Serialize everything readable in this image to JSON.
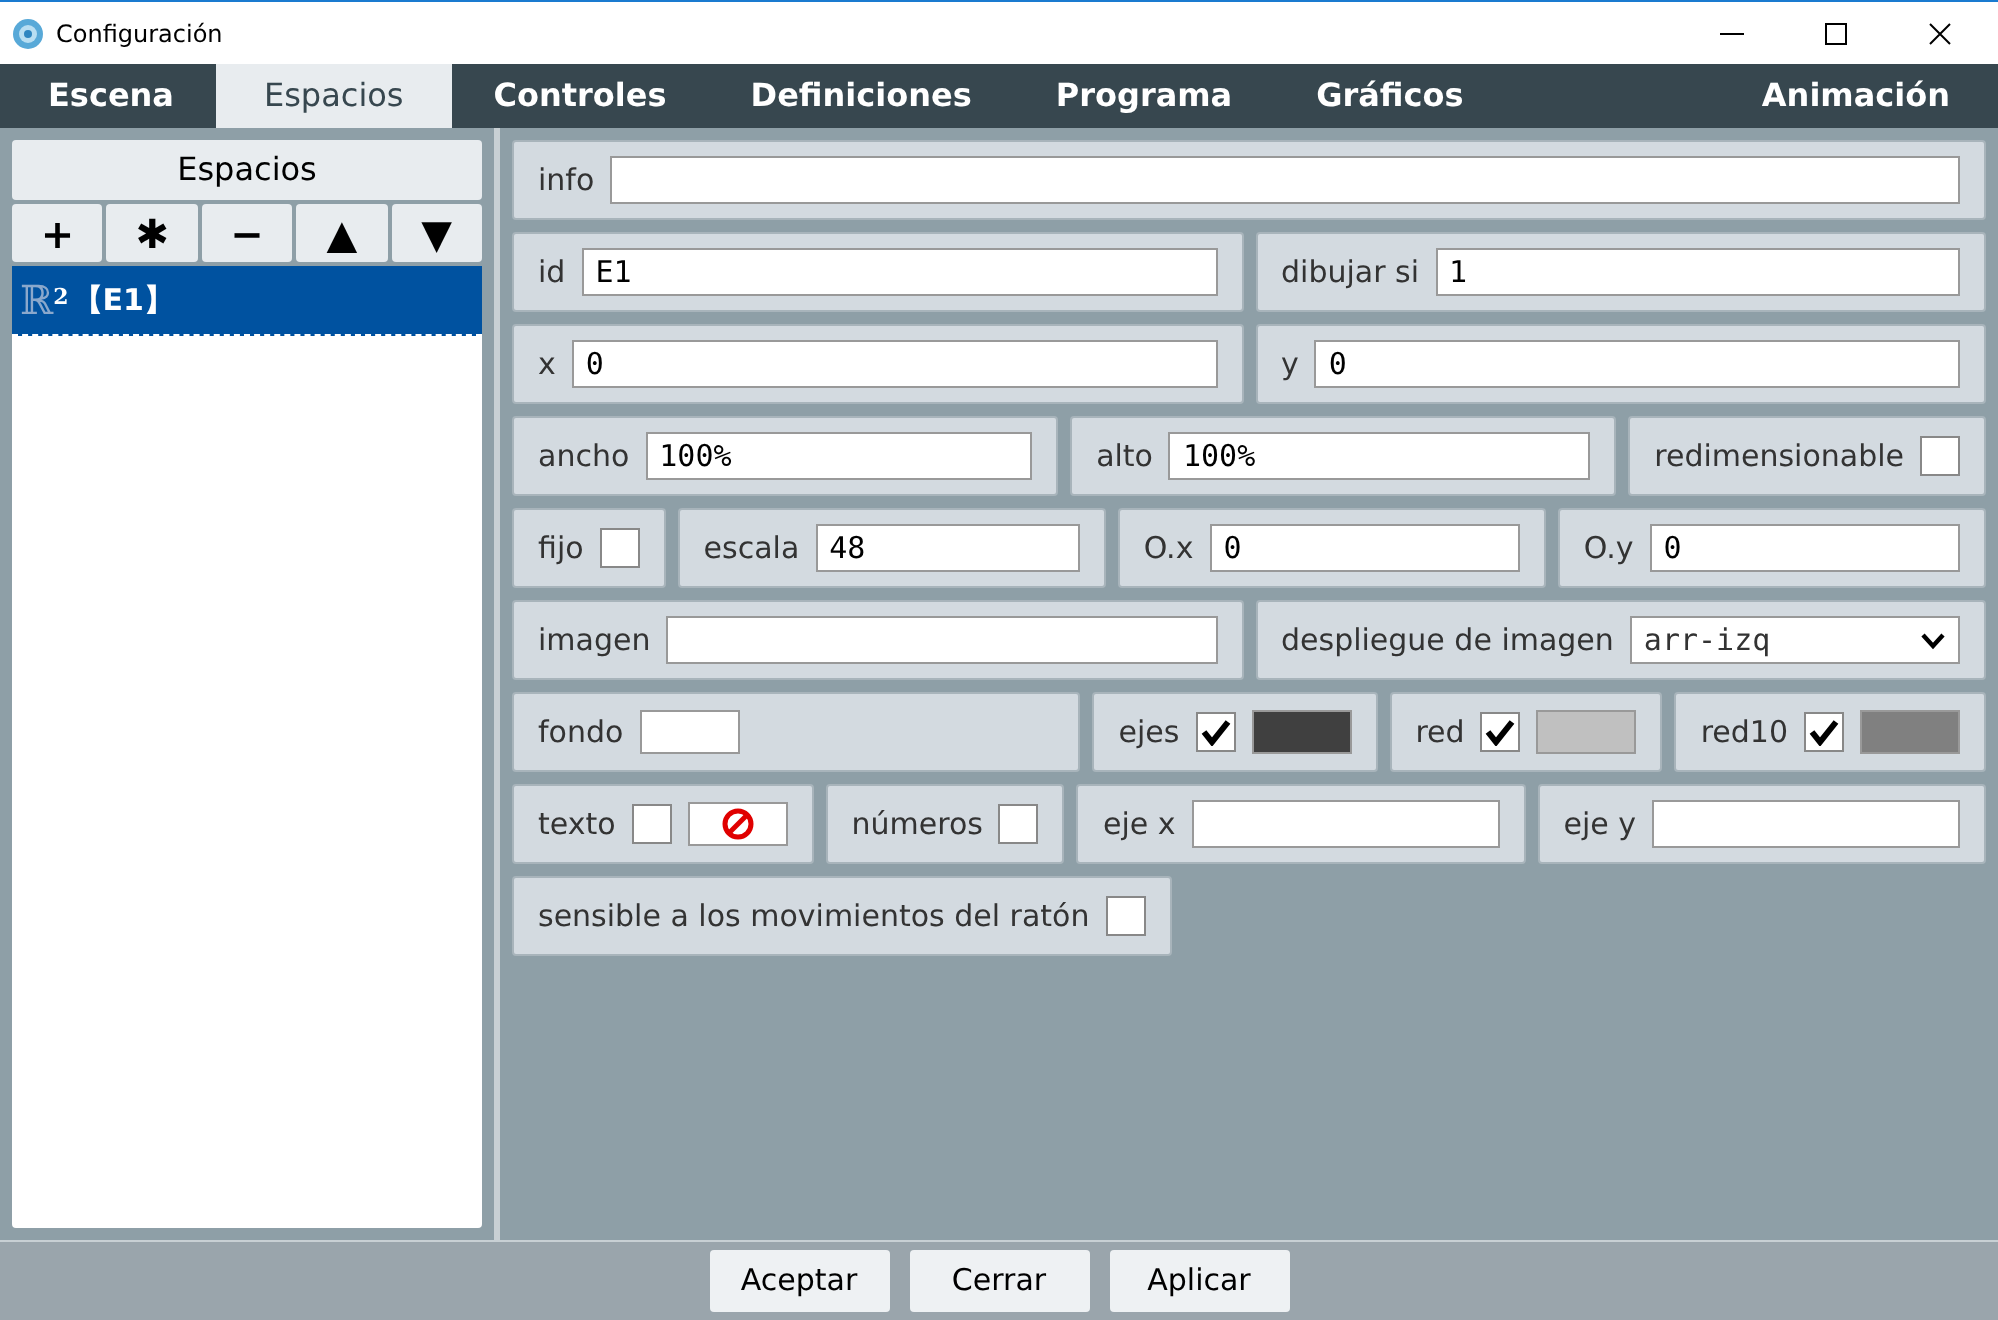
{
  "window": {
    "title": "Configuración"
  },
  "tabs": [
    {
      "label": "Escena",
      "selected": false
    },
    {
      "label": "Espacios",
      "selected": true
    },
    {
      "label": "Controles",
      "selected": false
    },
    {
      "label": "Definiciones",
      "selected": false
    },
    {
      "label": "Programa",
      "selected": false
    },
    {
      "label": "Gráficos",
      "selected": false
    },
    {
      "label": "Animación",
      "selected": false
    }
  ],
  "sidebar": {
    "title": "Espacios",
    "tools": [
      "+",
      "✱",
      "−",
      "▲",
      "▼"
    ],
    "items": [
      {
        "symbol": "ℝ",
        "exponent": "2",
        "label": "【E1】",
        "selected": true
      }
    ]
  },
  "rows": [
    [
      {
        "kind": "text",
        "label": "info"
      }
    ],
    [
      {
        "kind": "text",
        "label": "id",
        "value": "E1"
      },
      {
        "kind": "text",
        "label": "dibujar si",
        "value": "1"
      }
    ],
    [
      {
        "kind": "text",
        "label": "x",
        "value": "0"
      },
      {
        "kind": "text",
        "label": "y",
        "value": "0"
      }
    ],
    [
      {
        "kind": "text",
        "label": "ancho",
        "value": "100%"
      },
      {
        "kind": "text",
        "label": "alto",
        "value": "100%"
      },
      {
        "kind": "check",
        "label": "redimensionable",
        "checked": false
      }
    ],
    [
      {
        "kind": "check",
        "label": "fijo",
        "checked": false
      },
      {
        "kind": "text",
        "label": "escala",
        "value": "48"
      },
      {
        "kind": "text",
        "label": "O.x",
        "value": "0"
      },
      {
        "kind": "text",
        "label": "O.y",
        "value": "0"
      }
    ],
    [
      {
        "kind": "text",
        "label": "imagen"
      },
      {
        "kind": "select",
        "label": "despliegue de imagen",
        "value": "arr-izq"
      }
    ],
    [
      {
        "kind": "color",
        "label": "fondo",
        "color": "#ffffff"
      },
      {
        "kind": "check",
        "label": "ejes",
        "checked": true,
        "color": "#404040"
      },
      {
        "kind": "check",
        "label": "red",
        "checked": true,
        "color": "#c0c0c0"
      },
      {
        "kind": "check",
        "label": "red10",
        "checked": true,
        "color": "#808080"
      }
    ],
    [
      {
        "kind": "check",
        "label": "texto",
        "checked": false,
        "no_color": true
      },
      {
        "kind": "check",
        "label": "números",
        "checked": false
      },
      {
        "kind": "text",
        "label": "eje x"
      },
      {
        "kind": "text",
        "label": "eje y"
      }
    ],
    [
      {
        "kind": "check",
        "label": "sensible a los movimientos del ratón",
        "checked": false
      }
    ]
  ],
  "buttons": [
    "Aceptar",
    "Cerrar",
    "Aplicar"
  ]
}
